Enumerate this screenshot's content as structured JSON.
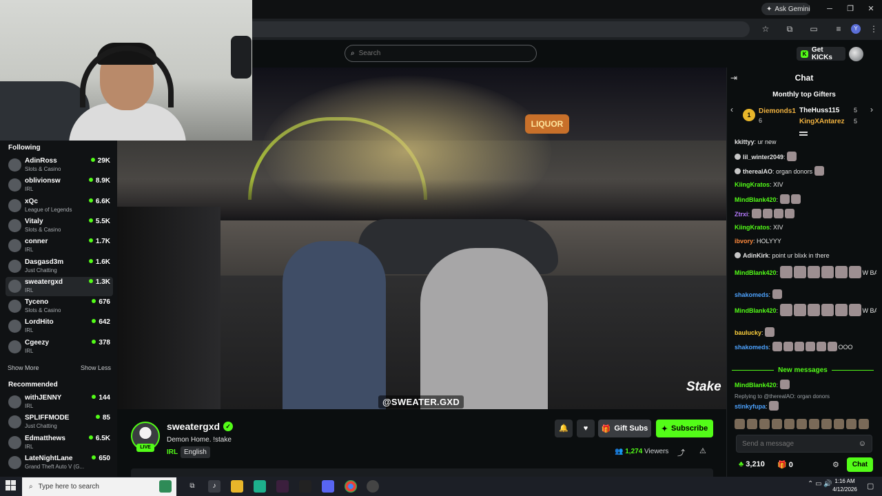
{
  "browser": {
    "ask_gemini": "Ask Gemini",
    "minimize": "─",
    "restore": "❐",
    "close": "✕",
    "profile_initial": "Y"
  },
  "header": {
    "search_placeholder": "Search",
    "get_kicks": "Get KICKs"
  },
  "sidebar": {
    "following_title": "Following",
    "following": [
      {
        "name": "AdinRoss",
        "category": "Slots & Casino",
        "viewers": "29K"
      },
      {
        "name": "oblivionsw",
        "category": "IRL",
        "viewers": "8.9K"
      },
      {
        "name": "xQc",
        "category": "League of Legends",
        "viewers": "6.6K"
      },
      {
        "name": "Vitaly",
        "category": "Slots & Casino",
        "viewers": "5.5K"
      },
      {
        "name": "conner",
        "category": "IRL",
        "viewers": "1.7K"
      },
      {
        "name": "Dasgasd3m",
        "category": "Just Chatting",
        "viewers": "1.6K"
      },
      {
        "name": "sweatergxd",
        "category": "IRL",
        "viewers": "1.3K"
      },
      {
        "name": "Tyceno",
        "category": "Slots & Casino",
        "viewers": "676"
      },
      {
        "name": "LordHito",
        "category": "IRL",
        "viewers": "642"
      },
      {
        "name": "Cgeezy",
        "category": "IRL",
        "viewers": "378"
      }
    ],
    "show_more": "Show More",
    "show_less": "Show Less",
    "recommended_title": "Recommended",
    "recommended": [
      {
        "name": "withJENNY",
        "category": "IRL",
        "viewers": "144"
      },
      {
        "name": "SPLIFFMODE",
        "category": "Just Chatting",
        "viewers": "85"
      },
      {
        "name": "Edmatthews",
        "category": "IRL",
        "viewers": "6.5K"
      },
      {
        "name": "LateNightLane",
        "category": "Grand Theft Auto V (G...",
        "viewers": "650"
      }
    ]
  },
  "video": {
    "watermark": "@SWEATER.GXD",
    "sponsor": "Stake",
    "sign_text": "LIQUOR"
  },
  "stream": {
    "streamer": "sweatergxd",
    "live": "LIVE",
    "title": "Demon Home. !stake",
    "category": "IRL",
    "language": "English",
    "gift_subs": "Gift Subs",
    "subscribe": "Subscribe",
    "viewers_count": "1,274",
    "viewers_label": "Viewers"
  },
  "chat": {
    "title": "Chat",
    "gifters_title": "Monthly top Gifters",
    "gifters": [
      {
        "name": "Diemonds1",
        "count": "6",
        "rank": "1"
      },
      {
        "name": "TheHuss115",
        "count": "5"
      },
      {
        "name": "KingXAntarez",
        "count": "5"
      }
    ],
    "messages": [
      {
        "user": "kkittyy",
        "color": "#e6e6e6",
        "text": "ur new"
      },
      {
        "user": "lil_winter2049",
        "color": "#e6e6e6",
        "text": ""
      },
      {
        "user": "therealAO",
        "color": "#e6e6e6",
        "text": "organ donors"
      },
      {
        "user": "KiingKratos",
        "color": "#53fc18",
        "text": "XIV"
      },
      {
        "user": "MindBlank420",
        "color": "#53fc18",
        "text": ""
      },
      {
        "user": "Ztrxi",
        "color": "#b77cff",
        "text": ""
      },
      {
        "user": "KiingKratos",
        "color": "#53fc18",
        "text": "XIV"
      },
      {
        "user": "ibvory",
        "color": "#ff8a3d",
        "text": "HOLYYY"
      },
      {
        "user": "AdinKirk",
        "color": "#e6e6e6",
        "text": "point ur blixk in there"
      },
      {
        "user": "MindBlank420",
        "color": "#53fc18",
        "text": "W BA NG"
      },
      {
        "user": "shakomeds",
        "color": "#4da3ff",
        "text": ""
      },
      {
        "user": "MindBlank420",
        "color": "#53fc18",
        "text": "W BA NG"
      },
      {
        "user": "baulucky",
        "color": "#ffd23d",
        "text": ""
      },
      {
        "user": "shakomeds",
        "color": "#4da3ff",
        "text": "OOO"
      }
    ],
    "new_messages": "New messages",
    "latest_user": "MindBlank420",
    "reply_text": "Replying to @therealAO: organ donors",
    "reply_user": "stinkyfupa",
    "input_placeholder": "Send a message",
    "kicks_balance": "3,210",
    "gift_count": "0",
    "send": "Chat"
  },
  "taskbar": {
    "search_placeholder": "Type here to search",
    "time": "1:16 AM",
    "date": "4/12/2026"
  },
  "colors": {
    "accent": "#53fc18",
    "background": "#0b0e0f",
    "panel": "#101214"
  }
}
